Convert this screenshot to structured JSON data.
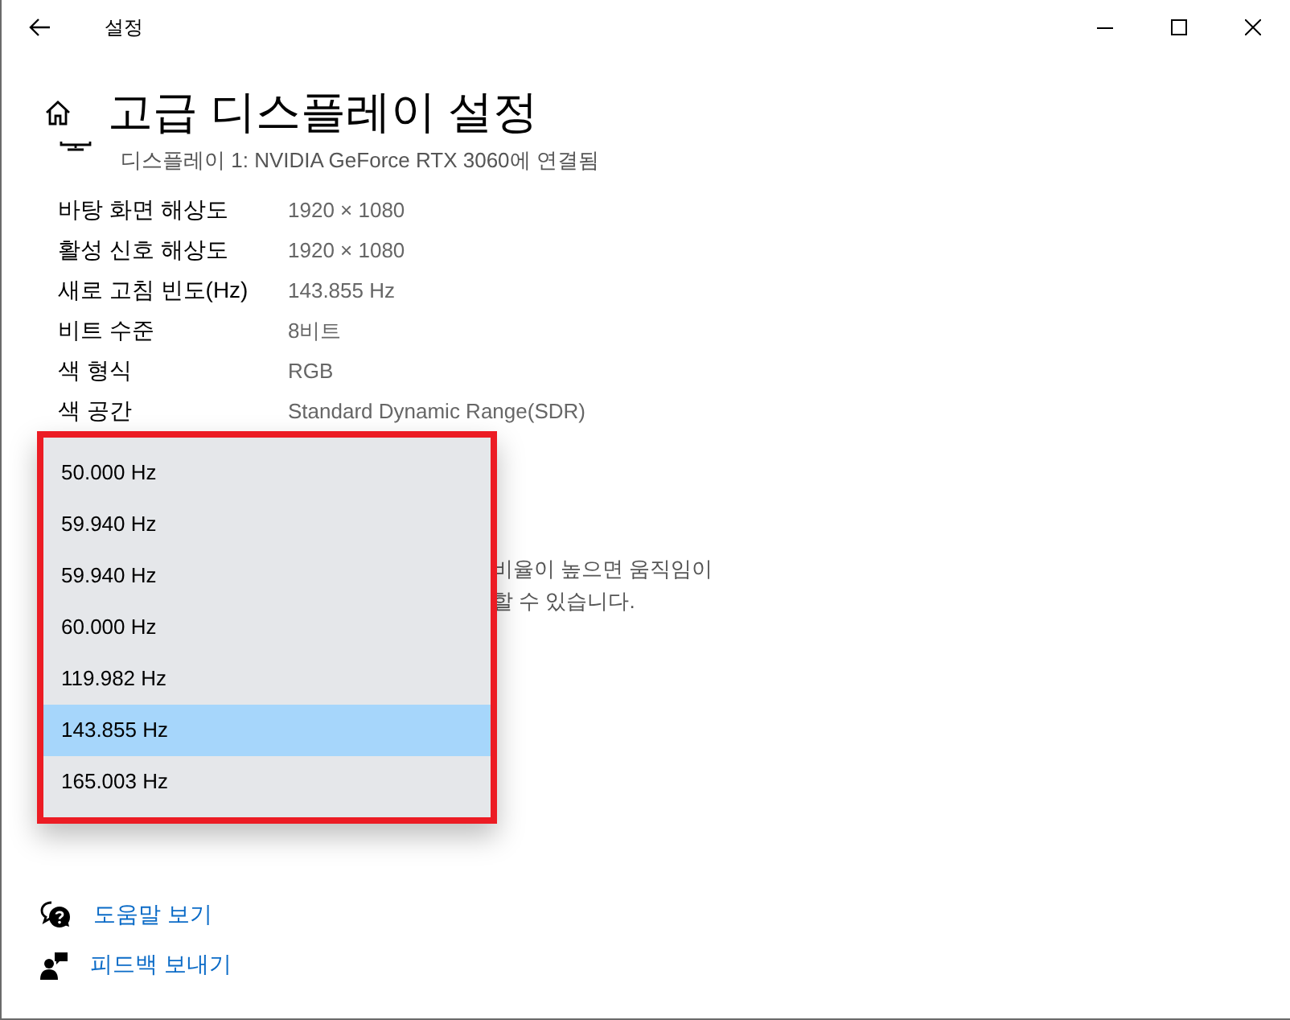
{
  "window": {
    "title": "설정"
  },
  "page": {
    "heading": "고급 디스플레이 설정",
    "connection": "디스플레이 1: NVIDIA GeForce RTX 3060에 연결됨"
  },
  "info_rows": [
    {
      "label": "바탕 화면 해상도",
      "value": "1920 × 1080"
    },
    {
      "label": "활성 신호 해상도",
      "value": "1920 × 1080"
    },
    {
      "label": "새로 고침 빈도(Hz)",
      "value": "143.855 Hz"
    },
    {
      "label": "비트 수준",
      "value": "8비트"
    },
    {
      "label": "색 형식",
      "value": "RGB"
    },
    {
      "label": "색 공간",
      "value": "Standard Dynamic Range(SDR)"
    }
  ],
  "note_lines": [
    "비율이 높으면 움직임이",
    "할 수 있습니다."
  ],
  "dropdown": {
    "options": [
      {
        "label": "50.000 Hz",
        "selected": false
      },
      {
        "label": "59.940 Hz",
        "selected": false
      },
      {
        "label": "59.940 Hz",
        "selected": false
      },
      {
        "label": "60.000 Hz",
        "selected": false
      },
      {
        "label": "119.982 Hz",
        "selected": false
      },
      {
        "label": "143.855 Hz",
        "selected": true
      },
      {
        "label": "165.003 Hz",
        "selected": false
      }
    ]
  },
  "links": [
    {
      "kind": "help",
      "label": "도움말 보기"
    },
    {
      "kind": "feedback",
      "label": "피드백 보내기"
    }
  ]
}
